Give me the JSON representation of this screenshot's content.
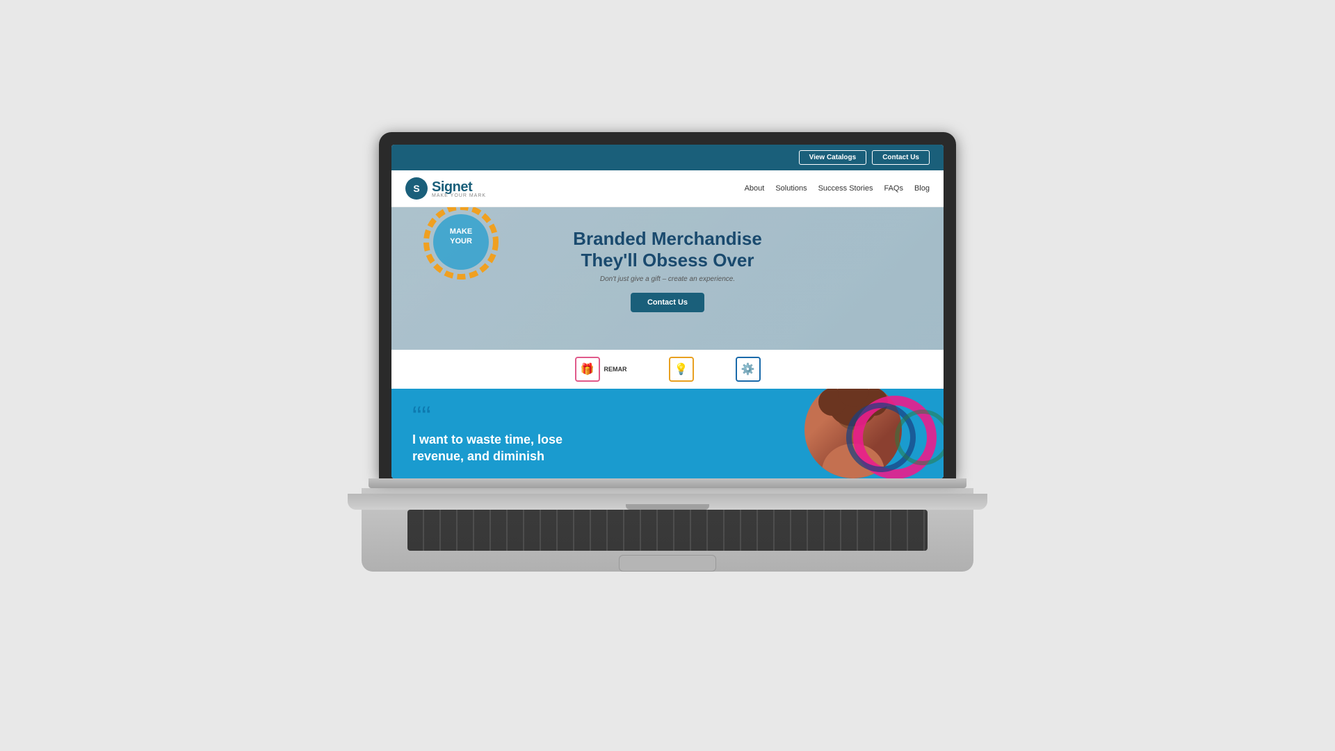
{
  "topbar": {
    "view_catalogs_label": "View Catalogs",
    "contact_us_label": "Contact Us"
  },
  "nav": {
    "logo_letter": "S",
    "brand_name": "Signet",
    "brand_tagline": "MAKE YOUR MARK",
    "links": [
      "About",
      "Solutions",
      "Success Stories",
      "FAQs",
      "Blog"
    ]
  },
  "hero": {
    "title_line1": "Branded Merchandise",
    "title_line2": "They'll Obsess Over",
    "subtitle": "Don't just give a gift – create an experience.",
    "cta_label": "Contact Us"
  },
  "icons_row": {
    "icon1_label": "REMAR",
    "icon2_label": "",
    "icon3_label": ""
  },
  "testimonial": {
    "quote_char": "““",
    "text_line1": "I want to waste time, lose",
    "text_line2": "revenue, and diminish"
  }
}
